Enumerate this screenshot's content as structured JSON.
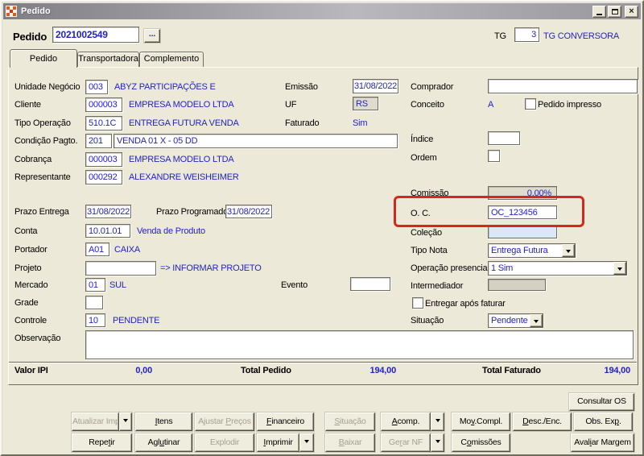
{
  "window": {
    "title": "Pedido"
  },
  "header": {
    "field_label": "Pedido",
    "field_value": "2021002549",
    "lookup_label": "...",
    "tg_label": "TG",
    "tg_value": "3",
    "tg_desc": "TG CONVERSORA"
  },
  "tabs": {
    "items": [
      {
        "label": "Pedido",
        "active": true
      },
      {
        "label": "Transportadora",
        "active": false
      },
      {
        "label": "Complemento",
        "active": false
      }
    ]
  },
  "form": {
    "unidade_negocio": {
      "label": "Unidade Negócio",
      "code": "003",
      "desc": "ABYZ PARTICIPAÇÕES E"
    },
    "cliente": {
      "label": "Cliente",
      "code": "000003",
      "desc": "EMPRESA MODELO LTDA"
    },
    "tipo_operacao": {
      "label": "Tipo Operação",
      "code": "510.1C",
      "desc": "ENTREGA FUTURA VENDA"
    },
    "condicao_pagto": {
      "label": "Condição Pagto.",
      "code": "201",
      "value": "VENDA 01 X - 05 DD"
    },
    "cobranca": {
      "label": "Cobrança",
      "code": "000003",
      "desc": "EMPRESA MODELO LTDA"
    },
    "representante": {
      "label": "Representante",
      "code": "000292",
      "desc": "ALEXANDRE WEISHEIMER"
    },
    "emissao": {
      "label": "Emissão",
      "value": "31/08/2022"
    },
    "uf": {
      "label": "UF",
      "value": "RS"
    },
    "faturado": {
      "label": "Faturado",
      "value": "Sim"
    },
    "comprador": {
      "label": "Comprador",
      "value": ""
    },
    "conceito": {
      "label": "Conceito",
      "value": "A"
    },
    "pedido_impresso": {
      "label": "Pedido impresso",
      "checked": false
    },
    "indice": {
      "label": "Índice",
      "value": ""
    },
    "ordem": {
      "label": "Ordem",
      "value": ""
    },
    "prazo_entrega": {
      "label": "Prazo Entrega",
      "value": "31/08/2022"
    },
    "prazo_programado": {
      "label": "Prazo Programado",
      "value": "31/08/2022"
    },
    "conta": {
      "label": "Conta",
      "code": "10.01.01",
      "desc": "Venda de Produto"
    },
    "portador": {
      "label": "Portador",
      "code": "A01",
      "desc": "CAIXA"
    },
    "projeto": {
      "label": "Projeto",
      "code": "",
      "desc": "=> INFORMAR PROJETO"
    },
    "mercado": {
      "label": "Mercado",
      "code": "01",
      "desc": "SUL"
    },
    "evento": {
      "label": "Evento",
      "value": ""
    },
    "grade": {
      "label": "Grade",
      "value": ""
    },
    "controle": {
      "label": "Controle",
      "code": "10",
      "desc": "PENDENTE"
    },
    "observacao": {
      "label": "Observação",
      "value": ""
    },
    "comissao": {
      "label": "Comissão",
      "value": "0,00%"
    },
    "oc": {
      "label": "O. C.",
      "value": "OC_123456"
    },
    "colecao": {
      "label": "Coleção",
      "value": ""
    },
    "tipo_nota": {
      "label": "Tipo Nota",
      "value": "Entrega Futura"
    },
    "operacao_presencial": {
      "label": "Operação presencial",
      "value": "1 Sim"
    },
    "intermediador": {
      "label": "Intermediador",
      "value": ""
    },
    "entregar_apos_faturar": {
      "label": "Entregar após faturar",
      "checked": false
    },
    "situacao": {
      "label": "Situação",
      "value": "Pendente"
    }
  },
  "totals": {
    "valor_ipi_label": "Valor IPI",
    "valor_ipi": "0,00",
    "total_pedido_label": "Total Pedido",
    "total_pedido": "194,00",
    "total_faturado_label": "Total Faturado",
    "total_faturado": "194,00"
  },
  "buttons": {
    "consultar_os": {
      "label": "Consultar OS",
      "accel": null,
      "disabled": false
    },
    "atualizar_imp": {
      "label": "Atualizar Imp",
      "accel": null,
      "disabled": true
    },
    "itens": {
      "label": "Itens",
      "accel": 0,
      "disabled": false
    },
    "ajustar_precos": {
      "label": "Ajustar Preços",
      "accel": 8,
      "disabled": true
    },
    "financeiro": {
      "label": "Financeiro",
      "accel": 0,
      "disabled": false
    },
    "situacao": {
      "label": "Situação",
      "accel": 0,
      "disabled": true
    },
    "acomp": {
      "label": "Acomp.",
      "accel": 0,
      "disabled": false
    },
    "mov_compl": {
      "label": "Mov.Compl.",
      "accel": 2,
      "disabled": false
    },
    "desc_enc": {
      "label": "Desc./Enc.",
      "accel": 0,
      "disabled": false
    },
    "obs_exp": {
      "label": "Obs. Exp.",
      "accel": 7,
      "disabled": false
    },
    "repetir": {
      "label": "Repetir",
      "accel": 4,
      "disabled": false
    },
    "aglutinar": {
      "label": "Aglutinar",
      "accel": 3,
      "disabled": false
    },
    "explodir": {
      "label": "Explodir",
      "accel": null,
      "disabled": true
    },
    "imprimir": {
      "label": "Imprimir",
      "accel": 0,
      "disabled": false
    },
    "baixar": {
      "label": "Baixar",
      "accel": 0,
      "disabled": true
    },
    "gerar_nf": {
      "label": "Gerar NF",
      "accel": 2,
      "disabled": true
    },
    "comissoes": {
      "label": "Comissões",
      "accel": 1,
      "disabled": false
    },
    "avaliar_margem": {
      "label": "Avaliar Margem",
      "accel": 4,
      "disabled": false
    }
  },
  "annotation": {
    "shape": "rounded-red-box",
    "color": "#D3291C",
    "target": "oc-field"
  },
  "icons": {
    "app": "app-grid-icon",
    "minimize": "minimize-icon",
    "maximize": "maximize-icon",
    "close": "close-icon",
    "lookup": "ellipsis-icon",
    "dropdown": "caret-down-icon"
  },
  "colors": {
    "value_text": "#2323C4",
    "window_bg": "#ECE9D8",
    "annotation_red": "#D3291C"
  }
}
